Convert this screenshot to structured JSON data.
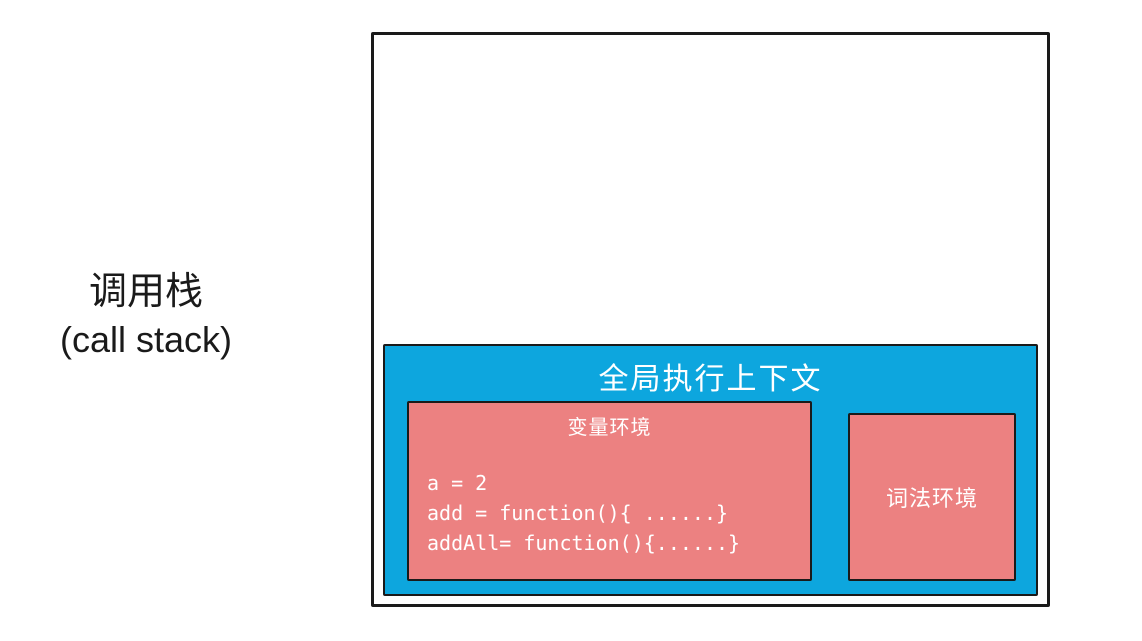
{
  "label": {
    "main": "调用栈",
    "sub": "(call stack)"
  },
  "global_context": {
    "title": "全局执行上下文",
    "variable_environment": {
      "title": "变量环境",
      "lines": [
        "a = 2",
        "add = function(){ ......}",
        "addAll= function(){......}"
      ]
    },
    "lexical_environment": {
      "title": "词法环境"
    }
  }
}
